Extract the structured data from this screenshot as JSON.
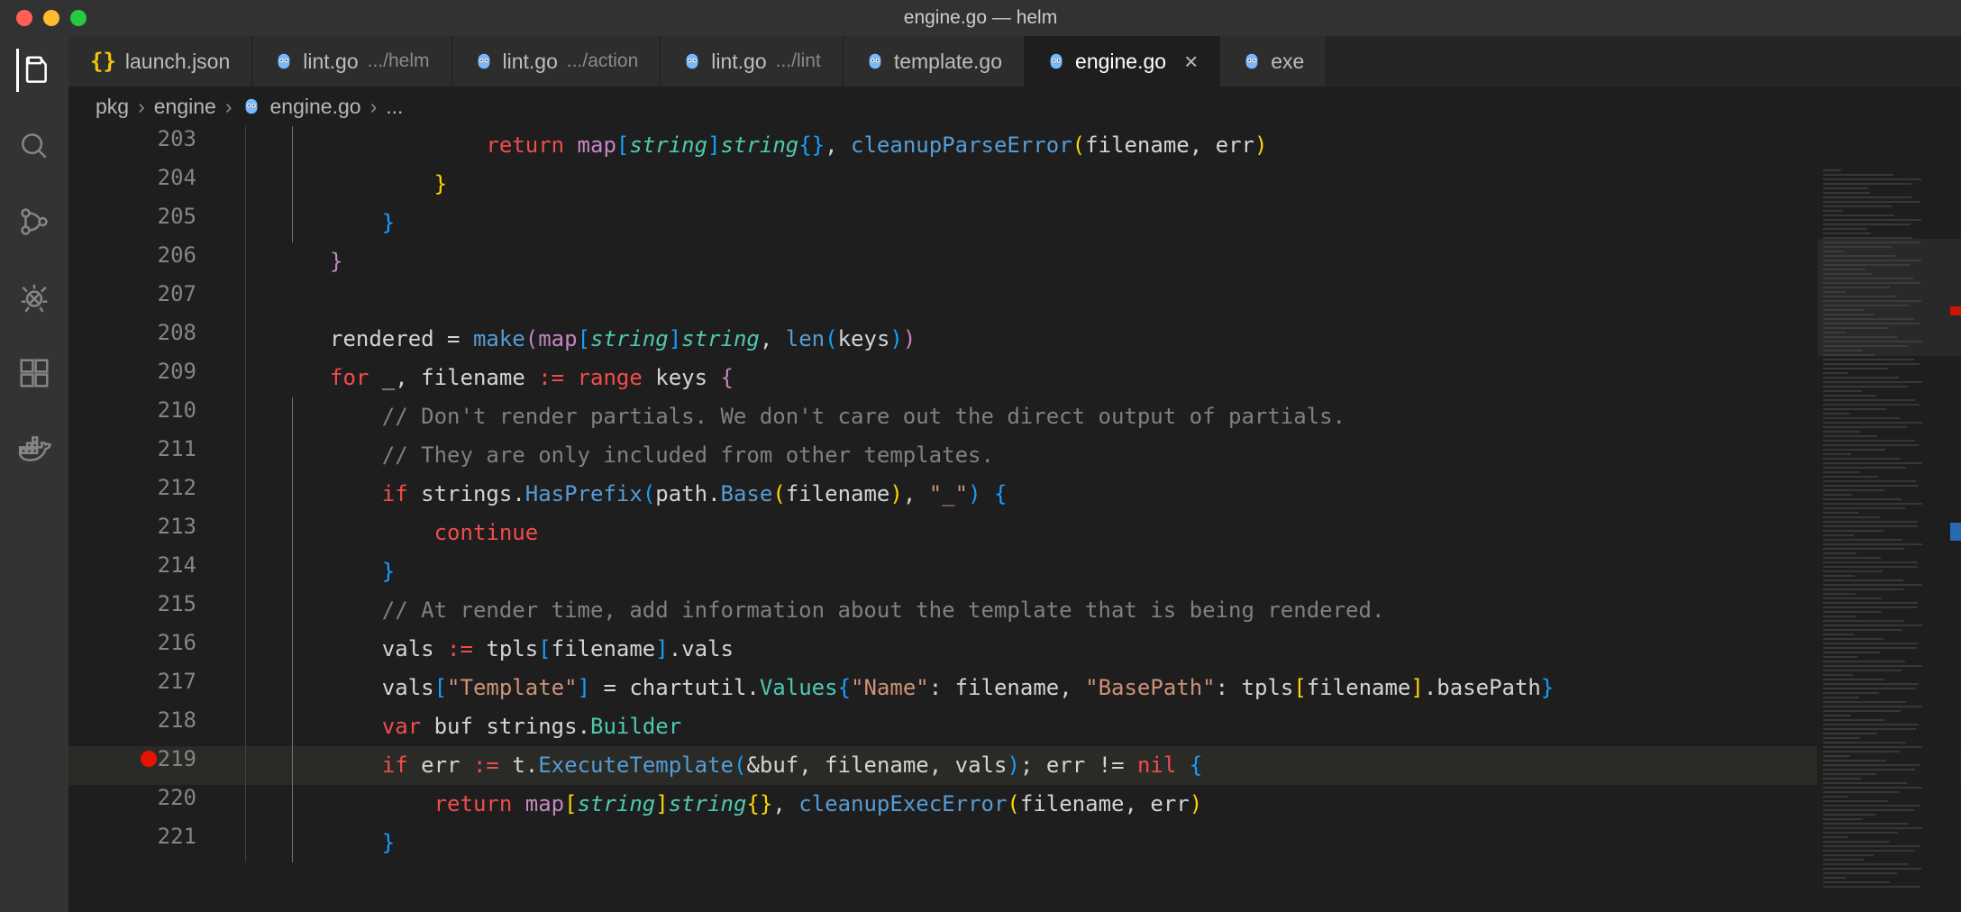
{
  "window": {
    "title": "engine.go — helm"
  },
  "tabs": [
    {
      "icon": "json",
      "label": "launch.json",
      "hint": ""
    },
    {
      "icon": "owl",
      "label": "lint.go",
      "hint": ".../helm"
    },
    {
      "icon": "owl",
      "label": "lint.go",
      "hint": ".../action"
    },
    {
      "icon": "owl",
      "label": "lint.go",
      "hint": ".../lint"
    },
    {
      "icon": "owl",
      "label": "template.go",
      "hint": ""
    },
    {
      "icon": "owl",
      "label": "engine.go",
      "hint": "",
      "active": true,
      "closeable": true
    },
    {
      "icon": "owl",
      "label": "exe",
      "hint": ""
    }
  ],
  "breadcrumbs": {
    "segments": [
      "pkg",
      "engine",
      "engine.go"
    ],
    "ellipsis": "..."
  },
  "editor": {
    "breakpoint_line": 219,
    "highlight_line": 219,
    "lines": [
      {
        "n": 203,
        "indents": [
          1,
          2
        ],
        "html": "            <span class='kw-red'>return</span> <span class='kw-purple'>map</span><span class='brace-b'>[</span><span class='type-cyan'>string</span><span class='brace-b'>]</span><span class='type-cyan'>string</span><span class='brace-b'>{}</span><span class='punc'>,</span> <span class='fn-blue'>cleanupParseError</span><span class='brace-y'>(</span><span class='var'>filename</span><span class='punc'>,</span> <span class='var'>err</span><span class='brace-y'>)</span>"
      },
      {
        "n": 204,
        "indents": [
          1,
          2
        ],
        "html": "        <span class='brace-y'>}</span>"
      },
      {
        "n": 205,
        "indents": [
          1,
          2
        ],
        "html": "    <span class='brace-b'>}</span>"
      },
      {
        "n": 206,
        "indents": [
          1
        ],
        "html": "<span class='brace-p'>}</span>"
      },
      {
        "n": 207,
        "indents": [
          1
        ],
        "html": ""
      },
      {
        "n": 208,
        "indents": [
          1
        ],
        "html": "<span class='var'>rendered</span> <span class='op'>=</span> <span class='fn-blue'>make</span><span class='brace-p'>(</span><span class='kw-purple'>map</span><span class='brace-b'>[</span><span class='type-cyan'>string</span><span class='brace-b'>]</span><span class='type-cyan'>string</span><span class='punc'>,</span> <span class='fn-blue'>len</span><span class='brace-b'>(</span><span class='var'>keys</span><span class='brace-b'>)</span><span class='brace-p'>)</span>"
      },
      {
        "n": 209,
        "indents": [
          1
        ],
        "html": "<span class='kw-red'>for</span> <span class='var'>_</span><span class='punc'>,</span> <span class='var'>filename</span> <span class='kw-red'>:=</span> <span class='kw-red'>range</span> <span class='var'>keys</span> <span class='brace-p'>{</span>"
      },
      {
        "n": 210,
        "indents": [
          1,
          2
        ],
        "html": "    <span class='comment'>// Don't render partials. We don't care out the direct output of partials.</span>"
      },
      {
        "n": 211,
        "indents": [
          1,
          2
        ],
        "html": "    <span class='comment'>// They are only included from other templates.</span>"
      },
      {
        "n": 212,
        "indents": [
          1,
          2
        ],
        "html": "    <span class='kw-red'>if</span> <span class='var'>strings</span><span class='punc'>.</span><span class='fn-blue'>HasPrefix</span><span class='brace-b'>(</span><span class='var'>path</span><span class='punc'>.</span><span class='fn-blue'>Base</span><span class='brace-y'>(</span><span class='var'>filename</span><span class='brace-y'>)</span><span class='punc'>,</span> <span class='str'>\"_\"</span><span class='brace-b'>)</span> <span class='brace-b'>{</span>"
      },
      {
        "n": 213,
        "indents": [
          1,
          2
        ],
        "html": "        <span class='kw-red'>continue</span>"
      },
      {
        "n": 214,
        "indents": [
          1,
          2
        ],
        "html": "    <span class='brace-b'>}</span>"
      },
      {
        "n": 215,
        "indents": [
          1,
          2
        ],
        "html": "    <span class='comment'>// At render time, add information about the template that is being rendered.</span>"
      },
      {
        "n": 216,
        "indents": [
          1,
          2
        ],
        "html": "    <span class='var'>vals</span> <span class='kw-red'>:=</span> <span class='var'>tpls</span><span class='brace-b'>[</span><span class='var'>filename</span><span class='brace-b'>]</span><span class='punc'>.</span><span class='var'>vals</span>"
      },
      {
        "n": 217,
        "indents": [
          1,
          2
        ],
        "html": "    <span class='var'>vals</span><span class='brace-b'>[</span><span class='str'>\"Template\"</span><span class='brace-b'>]</span> <span class='op'>=</span> <span class='var'>chartutil</span><span class='punc'>.</span><span class='type-cyan-plain'>Values</span><span class='brace-b'>{</span><span class='str'>\"Name\"</span><span class='punc'>:</span> <span class='var'>filename</span><span class='punc'>,</span> <span class='str'>\"BasePath\"</span><span class='punc'>:</span> <span class='var'>tpls</span><span class='brace-y'>[</span><span class='var'>filename</span><span class='brace-y'>]</span><span class='punc'>.</span><span class='var'>basePath</span><span class='brace-b'>}</span>"
      },
      {
        "n": 218,
        "indents": [
          1,
          2
        ],
        "html": "    <span class='kw-red'>var</span> <span class='var'>buf</span> <span class='var'>strings</span><span class='punc'>.</span><span class='type-cyan-plain'>Builder</span>"
      },
      {
        "n": 219,
        "indents": [
          1,
          2
        ],
        "html": "    <span class='kw-red'>if</span> <span class='var'>err</span> <span class='kw-red'>:=</span> <span class='var'>t</span><span class='punc'>.</span><span class='fn-blue'>ExecuteTemplate</span><span class='brace-b'>(</span><span class='op'>&amp;</span><span class='var'>buf</span><span class='punc'>,</span> <span class='var'>filename</span><span class='punc'>,</span> <span class='var'>vals</span><span class='brace-b'>)</span><span class='punc'>;</span> <span class='var'>err</span> <span class='op'>!=</span> <span class='kw-red'>nil</span> <span class='brace-b'>{</span>"
      },
      {
        "n": 220,
        "indents": [
          1,
          2
        ],
        "html": "        <span class='kw-red'>return</span> <span class='kw-purple'>map</span><span class='brace-y'>[</span><span class='type-cyan'>string</span><span class='brace-y'>]</span><span class='type-cyan'>string</span><span class='brace-y'>{}</span><span class='punc'>,</span> <span class='fn-blue'>cleanupExecError</span><span class='brace-y'>(</span><span class='var'>filename</span><span class='punc'>,</span> <span class='var'>err</span><span class='brace-y'>)</span>"
      },
      {
        "n": 221,
        "indents": [
          1,
          2
        ],
        "html": "    <span class='brace-b'>}</span>"
      }
    ]
  }
}
